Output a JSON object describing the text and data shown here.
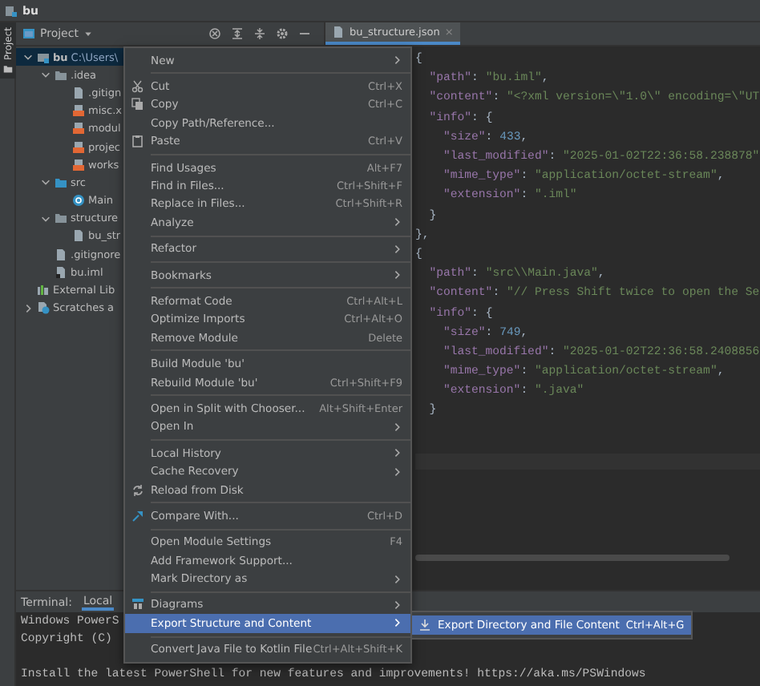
{
  "window": {
    "title": "bu"
  },
  "side_strip": {
    "tab": "Project"
  },
  "project_panel": {
    "title": "Project"
  },
  "tree": [
    {
      "label": "bu",
      "detail": "C:\\Users\\",
      "kind": "module",
      "expanded": true,
      "selected": true,
      "children": [
        {
          "label": ".idea",
          "kind": "folder",
          "expanded": true,
          "selected": false,
          "children": [
            {
              "label": ".gitign",
              "kind": "file",
              "selected": false
            },
            {
              "label": "misc.x",
              "kind": "xml",
              "selected": false
            },
            {
              "label": "modul",
              "kind": "xml",
              "selected": false
            },
            {
              "label": "projec",
              "kind": "xml",
              "selected": false
            },
            {
              "label": "works",
              "kind": "xml",
              "selected": false
            }
          ]
        },
        {
          "label": "src",
          "kind": "source",
          "expanded": true,
          "selected": false,
          "children": [
            {
              "label": "Main",
              "kind": "class",
              "selected": false
            }
          ]
        },
        {
          "label": "structure",
          "kind": "folder",
          "expanded": true,
          "selected": false,
          "children": [
            {
              "label": "bu_str",
              "kind": "file",
              "selected": false
            }
          ]
        },
        {
          "label": ".gitignore",
          "kind": "file",
          "selected": false
        },
        {
          "label": "bu.iml",
          "kind": "iml",
          "selected": false
        }
      ]
    },
    {
      "label": "External Lib",
      "kind": "library",
      "selected": false
    },
    {
      "label": "Scratches a",
      "kind": "scratches",
      "expanded": false,
      "selected": false
    }
  ],
  "editor": {
    "tab": "bu_structure.json",
    "close": "×",
    "lines": [
      "{",
      "  \"path\": \"bu.iml\",",
      "  \"content\": \"<?xml version=\\\"1.0\\\" encoding=\\\"UT",
      "  \"info\": {",
      "    \"size\": 433,",
      "    \"last_modified\": \"2025-01-02T22:36:58.238878\"",
      "    \"mime_type\": \"application/octet-stream\",",
      "    \"extension\": \".iml\"",
      "  }",
      "},",
      "{",
      "  \"path\": \"src\\\\Main.java\",",
      "  \"content\": \"// Press Shift twice to open the Se",
      "  \"info\": {",
      "    \"size\": 749,",
      "    \"last_modified\": \"2025-01-02T22:36:58.2408856",
      "    \"mime_type\": \"application/octet-stream\",",
      "    \"extension\": \".java\"",
      "  }"
    ]
  },
  "terminal": {
    "title": "Terminal:",
    "tab": "Local",
    "lines": [
      "Windows PowerS",
      "Copyright (C)"
    ],
    "notice": "Install the latest PowerShell for new features and improvements! https://aka.ms/PSWindows"
  },
  "context_menu": [
    {
      "kind": "item",
      "label": "New",
      "submenu": true,
      "selected": false
    },
    {
      "kind": "separator"
    },
    {
      "kind": "item",
      "label": "Cut",
      "shortcut": "Ctrl+X",
      "selected": false
    },
    {
      "kind": "item",
      "label": "Copy",
      "shortcut": "Ctrl+C",
      "selected": false
    },
    {
      "kind": "item",
      "label": "Copy Path/Reference...",
      "selected": false
    },
    {
      "kind": "item",
      "label": "Paste",
      "shortcut": "Ctrl+V",
      "selected": false
    },
    {
      "kind": "separator"
    },
    {
      "kind": "item",
      "label": "Find Usages",
      "shortcut": "Alt+F7",
      "selected": false
    },
    {
      "kind": "item",
      "label": "Find in Files...",
      "shortcut": "Ctrl+Shift+F",
      "selected": false
    },
    {
      "kind": "item",
      "label": "Replace in Files...",
      "shortcut": "Ctrl+Shift+R",
      "selected": false
    },
    {
      "kind": "item",
      "label": "Analyze",
      "submenu": true,
      "selected": false
    },
    {
      "kind": "separator"
    },
    {
      "kind": "item",
      "label": "Refactor",
      "submenu": true,
      "selected": false
    },
    {
      "kind": "separator"
    },
    {
      "kind": "item",
      "label": "Bookmarks",
      "submenu": true,
      "selected": false
    },
    {
      "kind": "separator"
    },
    {
      "kind": "item",
      "label": "Reformat Code",
      "shortcut": "Ctrl+Alt+L",
      "selected": false
    },
    {
      "kind": "item",
      "label": "Optimize Imports",
      "shortcut": "Ctrl+Alt+O",
      "selected": false
    },
    {
      "kind": "item",
      "label": "Remove Module",
      "shortcut": "Delete",
      "selected": false
    },
    {
      "kind": "separator"
    },
    {
      "kind": "item",
      "label": "Build Module 'bu'",
      "selected": false
    },
    {
      "kind": "item",
      "label": "Rebuild Module 'bu'",
      "shortcut": "Ctrl+Shift+F9",
      "selected": false
    },
    {
      "kind": "separator"
    },
    {
      "kind": "item",
      "label": "Open in Split with Chooser...",
      "shortcut": "Alt+Shift+Enter",
      "selected": false
    },
    {
      "kind": "item",
      "label": "Open In",
      "submenu": true,
      "selected": false
    },
    {
      "kind": "separator"
    },
    {
      "kind": "item",
      "label": "Local History",
      "submenu": true,
      "selected": false
    },
    {
      "kind": "item",
      "label": "Cache Recovery",
      "submenu": true,
      "selected": false
    },
    {
      "kind": "item",
      "label": "Reload from Disk",
      "selected": false
    },
    {
      "kind": "separator"
    },
    {
      "kind": "item",
      "label": "Compare With...",
      "shortcut": "Ctrl+D",
      "selected": false
    },
    {
      "kind": "separator"
    },
    {
      "kind": "item",
      "label": "Open Module Settings",
      "shortcut": "F4",
      "selected": false
    },
    {
      "kind": "item",
      "label": "Add Framework Support...",
      "selected": false
    },
    {
      "kind": "item",
      "label": "Mark Directory as",
      "submenu": true,
      "selected": false
    },
    {
      "kind": "separator"
    },
    {
      "kind": "item",
      "label": "Diagrams",
      "submenu": true,
      "selected": false
    },
    {
      "kind": "item",
      "label": "Export Structure and Content",
      "submenu": true,
      "selected": true,
      "submenu_items": [
        {
          "label": "Export Directory and File Content",
          "shortcut": "Ctrl+Alt+G",
          "selected": true
        }
      ]
    },
    {
      "kind": "separator"
    },
    {
      "kind": "item",
      "label": "Convert Java File to Kotlin File",
      "shortcut": "Ctrl+Alt+Shift+K",
      "selected": false
    }
  ]
}
